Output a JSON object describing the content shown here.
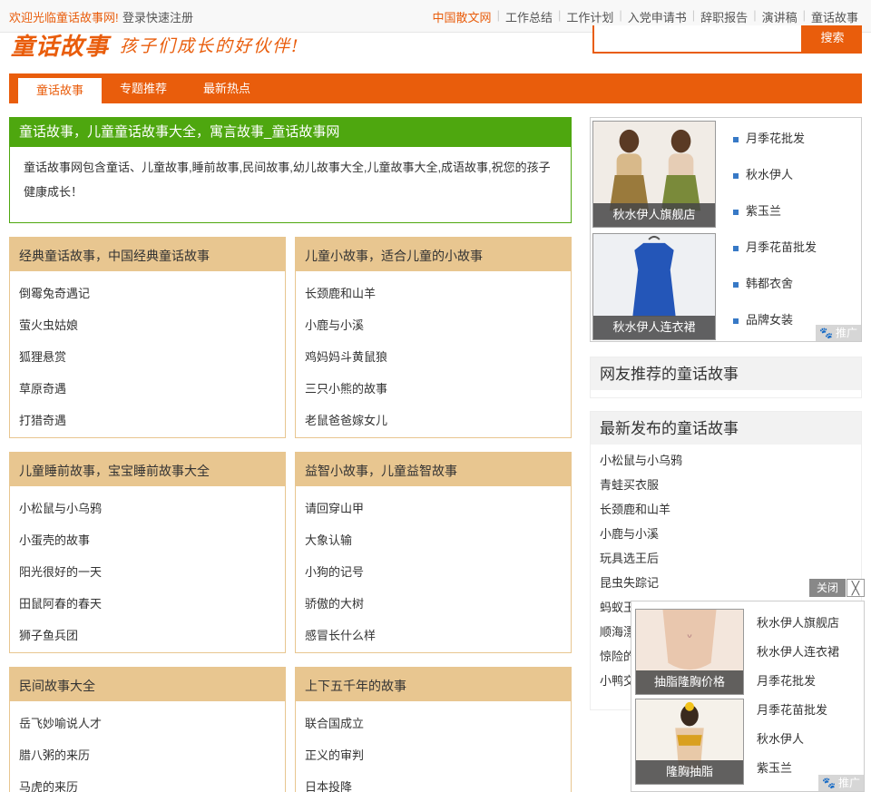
{
  "topbar": {
    "welcome": "欢迎光临童话故事网!",
    "register": "登录快速注册",
    "links": [
      "中国散文网",
      "工作总结",
      "工作计划",
      "入党申请书",
      "辞职报告",
      "演讲稿",
      "童话故事"
    ]
  },
  "header": {
    "logo": "童话故事",
    "slogan": "孩子们成长的好伙伴!",
    "search_button": "搜索"
  },
  "nav": {
    "tabs": [
      "童话故事",
      "专题推荐",
      "最新热点"
    ]
  },
  "intro": {
    "title": "童话故事，儿童童话故事大全，寓言故事_童话故事网",
    "description": "童话故事网包含童话、儿童故事,睡前故事,民间故事,幼儿故事大全,儿童故事大全,成语故事,祝您的孩子健康成长！"
  },
  "boxes": [
    {
      "title": "经典童话故事，中国经典童话故事",
      "items": [
        "倒霉兔奇遇记",
        "萤火虫姑娘",
        "狐狸悬赏",
        "草原奇遇",
        "打猎奇遇"
      ]
    },
    {
      "title": "儿童小故事，适合儿童的小故事",
      "items": [
        "长颈鹿和山羊",
        "小鹿与小溪",
        "鸡妈妈斗黄鼠狼",
        "三只小熊的故事",
        "老鼠爸爸嫁女儿"
      ]
    },
    {
      "title": "儿童睡前故事，宝宝睡前故事大全",
      "items": [
        "小松鼠与小乌鸦",
        "小蛋壳的故事",
        "阳光很好的一天",
        "田鼠阿春的春天",
        "狮子鱼兵团"
      ]
    },
    {
      "title": "益智小故事，儿童益智故事",
      "items": [
        "请回穿山甲",
        "大象认输",
        "小狗的记号",
        "骄傲的大树",
        "感冒长什么样"
      ]
    },
    {
      "title": "民间故事大全",
      "items": [
        "岳飞妙喻说人才",
        "腊八粥的来历",
        "马虎的来历"
      ]
    },
    {
      "title": "上下五千年的故事",
      "items": [
        "联合国成立",
        "正义的审判",
        "日本投降"
      ]
    }
  ],
  "ad1": {
    "images": [
      "秋水伊人旗舰店",
      "秋水伊人连衣裙"
    ],
    "items": [
      "月季花批发",
      "秋水伊人",
      "紫玉兰",
      "月季花苗批发",
      "韩都衣舍",
      "品牌女装"
    ],
    "promo": "推广"
  },
  "sidebar": {
    "recommended_title": "网友推荐的童话故事",
    "latest_title": "最新发布的童话故事",
    "latest_items": [
      "小松鼠与小乌鸦",
      "青蛙买衣服",
      "长颈鹿和山羊",
      "小鹿与小溪",
      "玩具选王后",
      "昆虫失踪记",
      "蚂蚁王",
      "顺海漂",
      "惊险的",
      "小鸭交"
    ]
  },
  "float_ad": {
    "close": "关闭",
    "close_x": "╳",
    "images": [
      "抽脂隆胸价格",
      "隆胸抽脂"
    ],
    "items": [
      "秋水伊人旗舰店",
      "秋水伊人连衣裙",
      "月季花批发",
      "月季花苗批发",
      "秋水伊人",
      "紫玉兰"
    ],
    "promo": "推广"
  }
}
